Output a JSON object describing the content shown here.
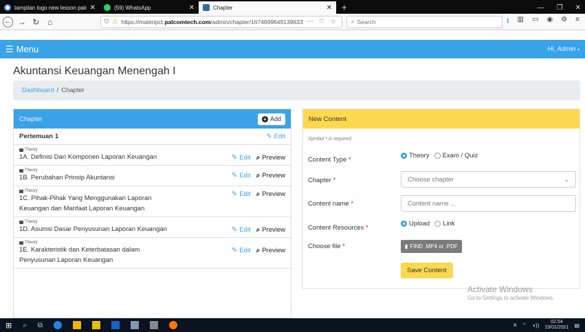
{
  "browser": {
    "tabs": [
      {
        "title": "tampilan logo new lesson palc",
        "icon": "google-icon"
      },
      {
        "title": "(59) WhatsApp",
        "icon": "whatsapp-icon"
      },
      {
        "title": "Chapter",
        "icon": "chapter-favicon"
      }
    ],
    "new_tab": "+",
    "url_prefix": "https://materipct.",
    "url_domain": "palcomtech.com",
    "url_path": "/admin/chapter/1674699649139633",
    "search_placeholder": "Search"
  },
  "app": {
    "menu_label": "Menu",
    "greeting": "Hi, Admin"
  },
  "page": {
    "title": "Akuntansi Keuangan Menengah I",
    "breadcrumb_home": "Dashboard",
    "breadcrumb_sep": "/",
    "breadcrumb_current": "Chapter"
  },
  "chapter_panel": {
    "title": "Chapter",
    "add_label": "Add",
    "meeting_title": "Pertemuan 1",
    "edit_label": "Edit",
    "preview_label": "Preview",
    "items": [
      {
        "type": "Theory",
        "title": "1A. Definisi Dan Komponen Laporan Keuangan"
      },
      {
        "type": "Theory",
        "title": "1B. Perubahan Prinsip Akuntansi"
      },
      {
        "type": "Theory",
        "title": "1C. Pihak-Pihak Yang Menggunakan Laporan Keuangan dan Manfaat Laporan Keuangan"
      },
      {
        "type": "Theory",
        "title": "1D. Asumsi Dasar Penyusunan Laporan Keuangan"
      },
      {
        "type": "Theory",
        "title": "1E. Karakteristik dan Keterbatasan dalam Penyusunan Laporan Keuangan"
      }
    ]
  },
  "new_content": {
    "title": "New Content",
    "required_note": "Symbol * is required.",
    "content_type_label": "Content Type",
    "content_type_options": [
      "Theory",
      "Exam / Quiz"
    ],
    "chapter_label": "Chapter",
    "chapter_placeholder": "Choose chapter",
    "content_name_label": "Content name",
    "content_name_placeholder": "Content name ...",
    "resources_label": "Content Resources",
    "resources_options": [
      "Upload",
      "Link"
    ],
    "file_label": "Choose file",
    "file_button": "FIND .MP4 or .PDF",
    "save_label": "Save Content",
    "required_mark": "*"
  },
  "watermark": {
    "line1": "Activate Windows",
    "line2": "Go to Settings to activate Windows."
  },
  "taskbar": {
    "time": "02.54",
    "date": "19/01/2021"
  }
}
